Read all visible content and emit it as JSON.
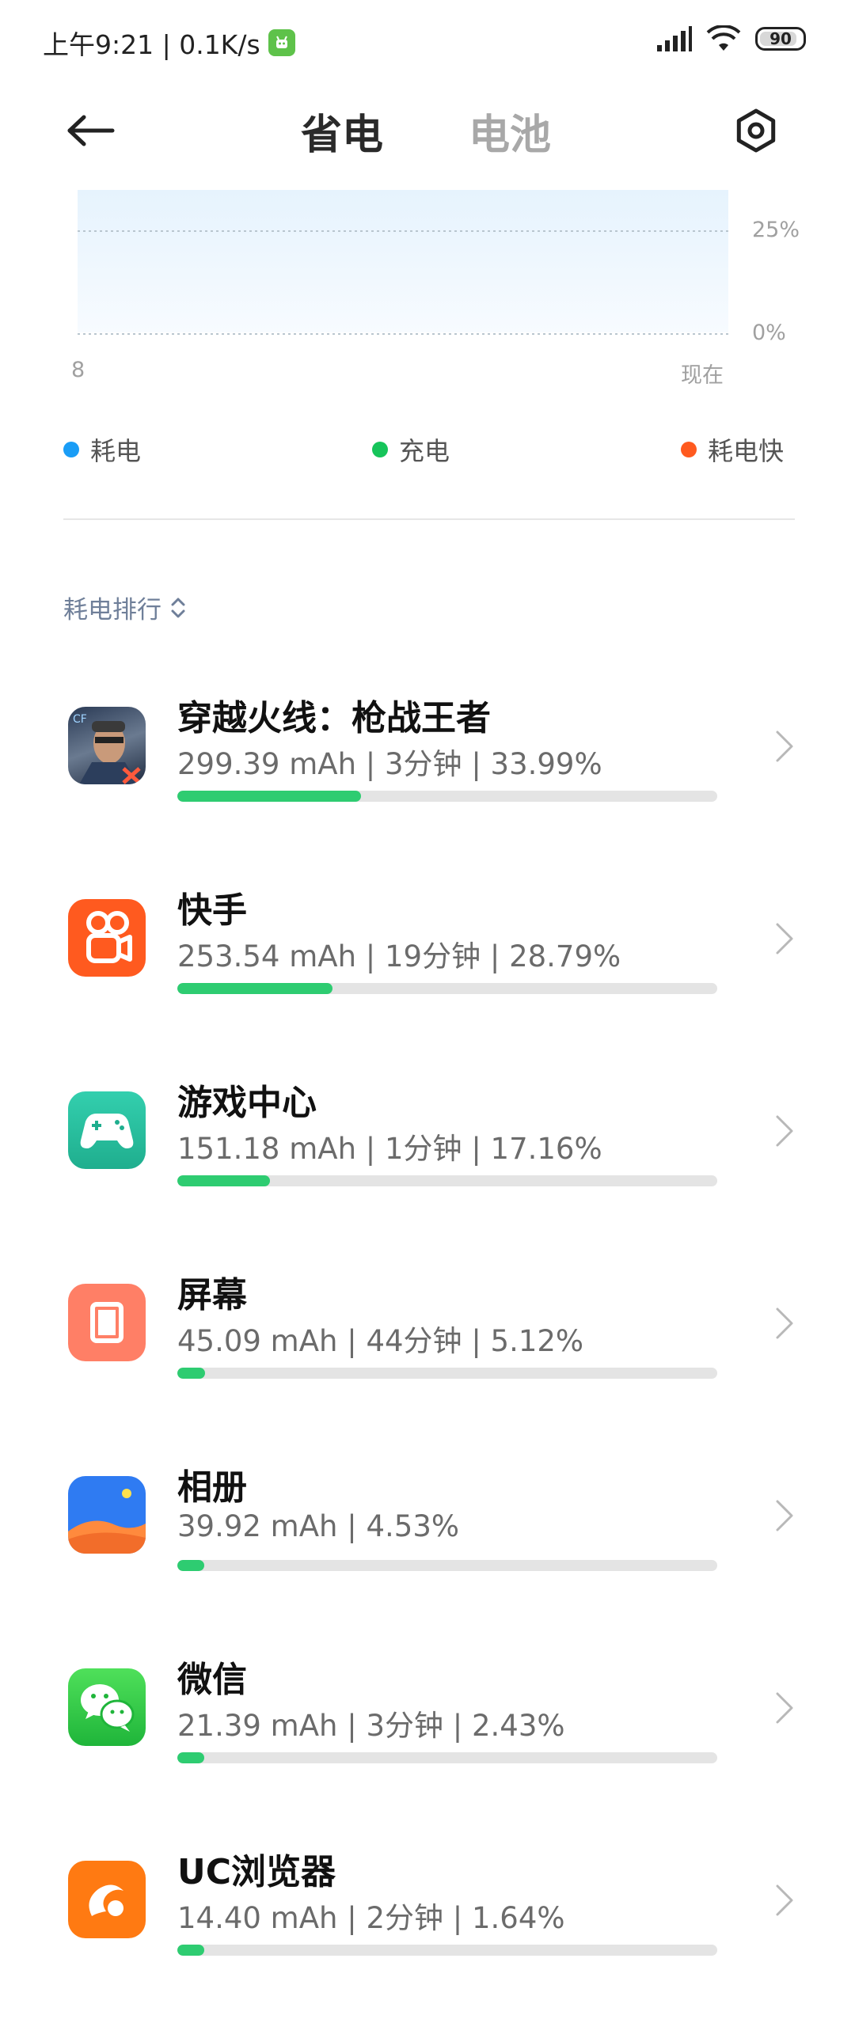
{
  "status_bar": {
    "time_speed": "上午9:21 | 0.1K/s",
    "battery": "90"
  },
  "header": {
    "tab_active": "省电",
    "tab_inactive": "电池"
  },
  "chart_data": {
    "type": "area",
    "y_ticks": [
      "25%",
      "0%"
    ],
    "x_start": "8",
    "x_end": "现在",
    "ylim": [
      0,
      25
    ],
    "values": []
  },
  "legend": [
    {
      "label": "耗电",
      "color": "#1a9df6"
    },
    {
      "label": "充电",
      "color": "#16c45a"
    },
    {
      "label": "耗电快",
      "color": "#ff5a1f"
    }
  ],
  "sort": {
    "label": "耗电排行"
  },
  "apps": [
    {
      "name": "穿越火线：枪战王者",
      "stats": "299.39 mAh | 3分钟 | 33.99%",
      "percent": 33.99,
      "icon": "game-cf-icon"
    },
    {
      "name": "快手",
      "stats": "253.54 mAh | 19分钟 | 28.79%",
      "percent": 28.79,
      "icon": "kuaishou-icon"
    },
    {
      "name": "游戏中心",
      "stats": "151.18 mAh | 1分钟 | 17.16%",
      "percent": 17.16,
      "icon": "game-center-icon"
    },
    {
      "name": "屏幕",
      "stats": "45.09 mAh | 44分钟 | 5.12%",
      "percent": 5.12,
      "icon": "screen-icon"
    },
    {
      "name": "相册",
      "stats": "39.92 mAh | 4.53%",
      "percent": 4.53,
      "icon": "gallery-icon"
    },
    {
      "name": "微信",
      "stats": "21.39 mAh | 3分钟 | 2.43%",
      "percent": 2.43,
      "icon": "wechat-icon"
    },
    {
      "name": "UC浏览器",
      "stats": "14.40 mAh | 2分钟 | 1.64%",
      "percent": 1.64,
      "icon": "uc-browser-icon"
    }
  ]
}
